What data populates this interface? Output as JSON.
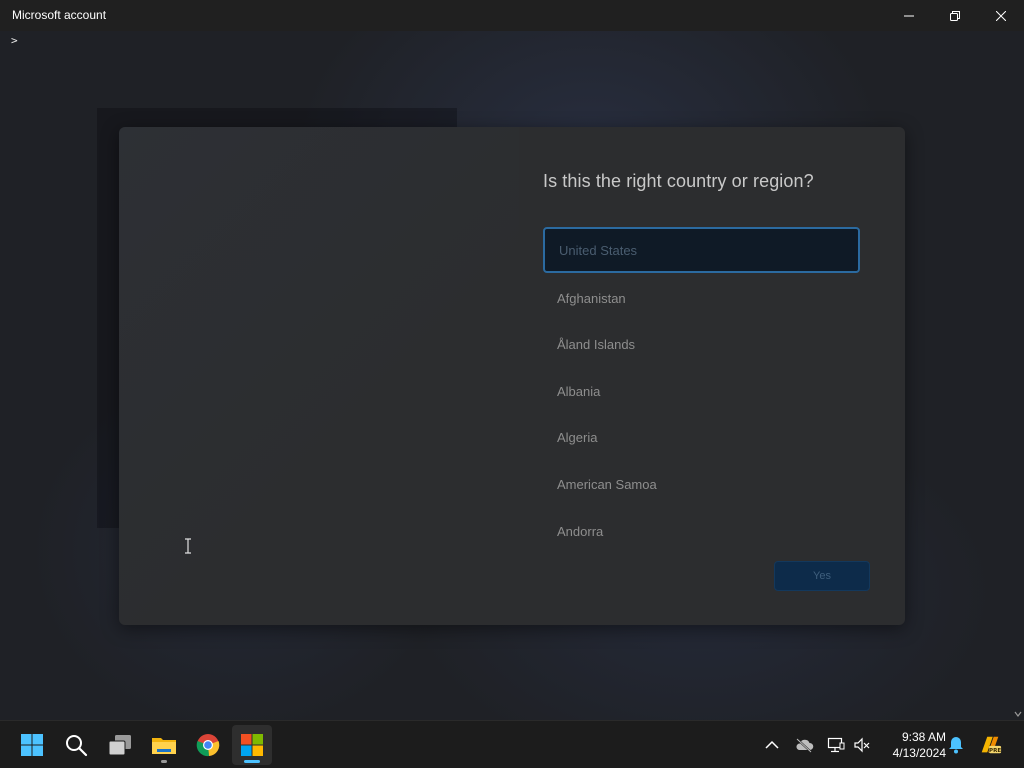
{
  "window": {
    "title": "Microsoft account",
    "minimize_icon": "minimize-icon",
    "maximize_icon": "restore-icon",
    "close_icon": "close-icon"
  },
  "content": {
    "prompt_glyph": ">"
  },
  "dialog": {
    "heading": "Is this the right country or region?",
    "countries": [
      "United States",
      "Afghanistan",
      "Åland Islands",
      "Albania",
      "Algeria",
      "American Samoa",
      "Andorra"
    ],
    "selected_country": "United States",
    "confirm_label": "Yes"
  },
  "taskbar": {
    "apps": [
      {
        "name": "start",
        "icon": "windows-logo-icon"
      },
      {
        "name": "search",
        "icon": "search-icon"
      },
      {
        "name": "task-view",
        "icon": "task-view-icon"
      },
      {
        "name": "file-explorer",
        "icon": "folder-icon"
      },
      {
        "name": "chrome",
        "icon": "chrome-icon"
      },
      {
        "name": "microsoft-store",
        "icon": "microsoft-store-icon"
      }
    ],
    "tray": {
      "icons": [
        "chevron-up-icon",
        "onedrive-offline-icon",
        "network-icon",
        "volume-muted-icon",
        "notification-bell-icon",
        "copilot-pre-icon"
      ],
      "time": "9:38 AM",
      "date": "4/13/2024"
    }
  },
  "colors": {
    "accent": "#2b6aa0",
    "dialog_bg": "#2c2d2f",
    "taskbar_bg": "#1c1c1c",
    "active_indicator": "#4cc2ff"
  }
}
